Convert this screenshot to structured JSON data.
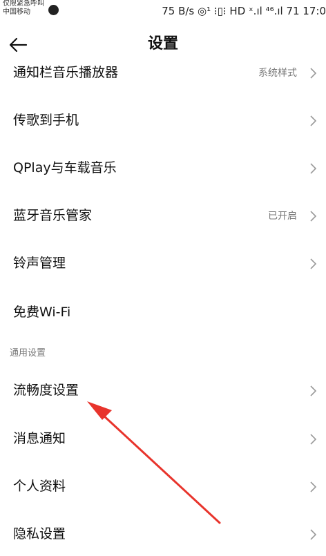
{
  "status_bar": {
    "carrier_line1": "仅限紧急呼叫",
    "carrier_line2": "中国移动",
    "right_text": "75 B/s ◎¹ ⁝▯⁝ HD ˣ.ıl ⁴⁶.ıl 71 17:0"
  },
  "header": {
    "title": "设置"
  },
  "list": {
    "items": [
      {
        "label": "通知栏音乐播放器",
        "value": "系统样式"
      },
      {
        "label": "传歌到手机",
        "value": ""
      },
      {
        "label": "QPlay与车载音乐",
        "value": ""
      },
      {
        "label": "蓝牙音乐管家",
        "value": "已开启"
      },
      {
        "label": "铃声管理",
        "value": ""
      },
      {
        "label": "免费Wi-Fi",
        "value": ""
      }
    ],
    "section_label": "通用设置",
    "general_items": [
      {
        "label": "流畅度设置"
      },
      {
        "label": "消息通知"
      },
      {
        "label": "个人资料"
      },
      {
        "label": "隐私设置"
      }
    ]
  },
  "colors": {
    "annotation_arrow": "#e8342c",
    "chevron": "#9a9a9a"
  }
}
